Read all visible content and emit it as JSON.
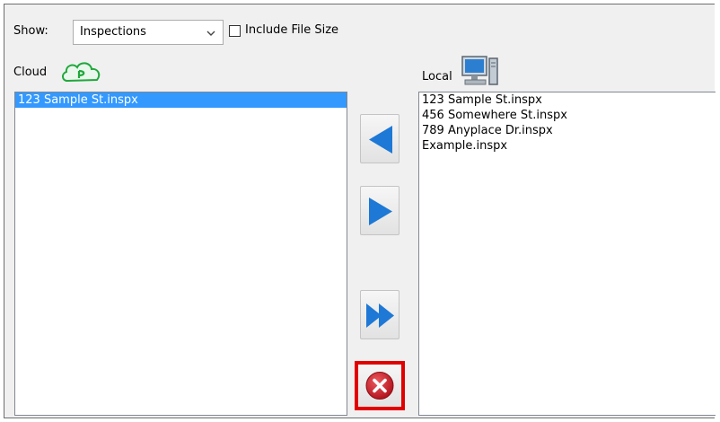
{
  "toolbar": {
    "show_label": "Show:",
    "show_value": "Inspections",
    "include_file_size_label": "Include File Size",
    "include_file_size_checked": false
  },
  "cloud": {
    "label": "Cloud",
    "items": [
      {
        "name": "123 Sample St.inspx",
        "selected": true
      }
    ]
  },
  "local": {
    "label": "Local",
    "items": [
      {
        "name": "123 Sample St.inspx",
        "selected": false
      },
      {
        "name": "456 Somewhere St.inspx",
        "selected": false
      },
      {
        "name": "789 Anyplace Dr.inspx",
        "selected": false
      },
      {
        "name": "Example.inspx",
        "selected": false
      }
    ]
  },
  "buttons": {
    "move_left_icon": "arrow-left-icon",
    "move_right_icon": "arrow-right-icon",
    "move_all_right_icon": "double-arrow-right-icon",
    "cancel_icon": "cancel-x-icon"
  },
  "colors": {
    "selection": "#3399ff",
    "arrow_blue": "#1e78d6",
    "cancel_red": "#c0202a",
    "highlight_border": "#e10000",
    "cloud_green": "#1fa83c"
  }
}
